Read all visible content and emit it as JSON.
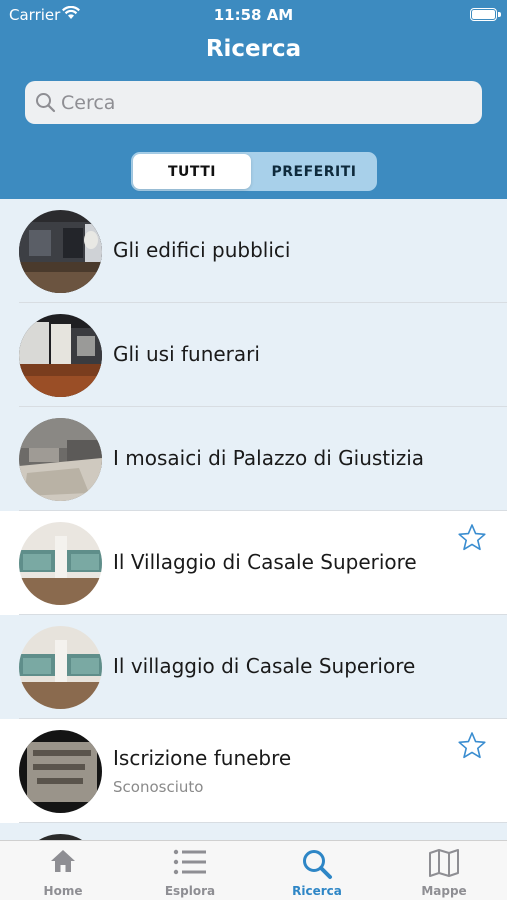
{
  "status": {
    "carrier": "Carrier",
    "time": "11:58 AM"
  },
  "header": {
    "title": "Ricerca"
  },
  "search": {
    "placeholder": "Cerca"
  },
  "segments": {
    "all": "TUTTI",
    "favorites": "PREFERITI"
  },
  "colors": {
    "header": "#3d8bc0",
    "accent": "#2e86c6",
    "row_tint": "#e7f0f7"
  },
  "items": [
    {
      "title": "Gli edifici pubblici",
      "subtitle": "",
      "favorite": false,
      "thumb": "museum-hall-dark"
    },
    {
      "title": "Gli usi funerari",
      "subtitle": "",
      "favorite": false,
      "thumb": "museum-room-wood-floor"
    },
    {
      "title": "I mosaici di Palazzo di Giustizia",
      "subtitle": "",
      "favorite": false,
      "thumb": "mosaic-room"
    },
    {
      "title": "Il Villaggio di Casale Superiore",
      "subtitle": "",
      "favorite": true,
      "thumb": "exhibition-vitrines"
    },
    {
      "title": "Il villaggio di Casale Superiore",
      "subtitle": "",
      "favorite": false,
      "thumb": "exhibition-vitrines"
    },
    {
      "title": "Iscrizione funebre",
      "subtitle": "Sconosciuto",
      "favorite": true,
      "thumb": "stone-inscription"
    }
  ],
  "tabbar": [
    {
      "label": "Home",
      "icon": "home-icon"
    },
    {
      "label": "Esplora",
      "icon": "list-icon"
    },
    {
      "label": "Ricerca",
      "icon": "search-icon",
      "active": true
    },
    {
      "label": "Mappe",
      "icon": "map-icon"
    }
  ]
}
